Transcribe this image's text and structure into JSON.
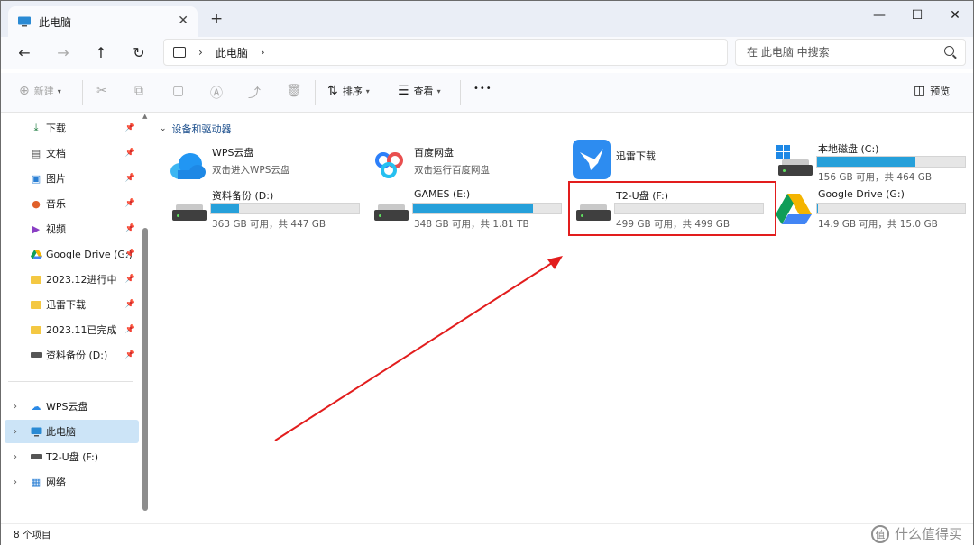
{
  "tab": {
    "title": "此电脑",
    "close_glyph": "✕",
    "new_tab_glyph": "+"
  },
  "window_controls": {
    "minimize": "—",
    "maximize": "☐",
    "close": "✕"
  },
  "nav": {
    "back": "←",
    "forward": "→",
    "up": "↑",
    "refresh": "↻"
  },
  "address": {
    "path": "此电脑",
    "sep": "›"
  },
  "search": {
    "placeholder": "在 此电脑 中搜索"
  },
  "toolbar": {
    "new_label": "新建",
    "sort_label": "排序",
    "view_label": "查看",
    "more_glyph": "•••",
    "preview_label": "预览"
  },
  "sidebar": {
    "quick_access": [
      {
        "label": "下载",
        "icon": "download-icon"
      },
      {
        "label": "文档",
        "icon": "document-icon"
      },
      {
        "label": "图片",
        "icon": "picture-icon"
      },
      {
        "label": "音乐",
        "icon": "music-icon"
      },
      {
        "label": "视频",
        "icon": "video-icon"
      },
      {
        "label": "Google Drive (G:)",
        "icon": "google-drive-icon"
      },
      {
        "label": "2023.12进行中",
        "icon": "folder-icon"
      },
      {
        "label": "迅雷下载",
        "icon": "folder-icon"
      },
      {
        "label": "2023.11已完成",
        "icon": "folder-icon"
      },
      {
        "label": "资料备份 (D:)",
        "icon": "drive-icon"
      }
    ],
    "roots": [
      {
        "label": "WPS云盘",
        "icon": "cloud-icon"
      },
      {
        "label": "此电脑",
        "icon": "computer-icon"
      },
      {
        "label": "T2-U盘 (F:)",
        "icon": "usb-drive-icon"
      },
      {
        "label": "网络",
        "icon": "network-icon"
      }
    ]
  },
  "main": {
    "group_title": "设备和驱动器",
    "apps": [
      {
        "name": "WPS云盘",
        "sub": "双击进入WPS云盘"
      },
      {
        "name": "百度网盘",
        "sub": "双击运行百度网盘"
      },
      {
        "name": "迅雷下载"
      }
    ],
    "drives": [
      {
        "name": "本地磁盘 (C:)",
        "free": "156 GB 可用，共 464 GB",
        "used_fraction": 0.664
      },
      {
        "name": "资料备份 (D:)",
        "free": "363 GB 可用，共 447 GB",
        "used_fraction": 0.188
      },
      {
        "name": "GAMES (E:)",
        "free": "348 GB 可用，共 1.81 TB",
        "used_fraction": 0.812
      },
      {
        "name": "T2-U盘 (F:)",
        "free": "499 GB 可用，共 499 GB",
        "used_fraction": 0.0
      },
      {
        "name": "Google Drive (G:)",
        "free": "14.9 GB 可用，共 15.0 GB",
        "used_fraction": 0.007
      }
    ]
  },
  "status": {
    "count": "8 个项目"
  },
  "watermark": {
    "text": "什么值得买",
    "glyph": "值"
  },
  "colors": {
    "accent": "#26a0da",
    "highlight": "#e21d1d",
    "selected": "#cce4f7"
  }
}
